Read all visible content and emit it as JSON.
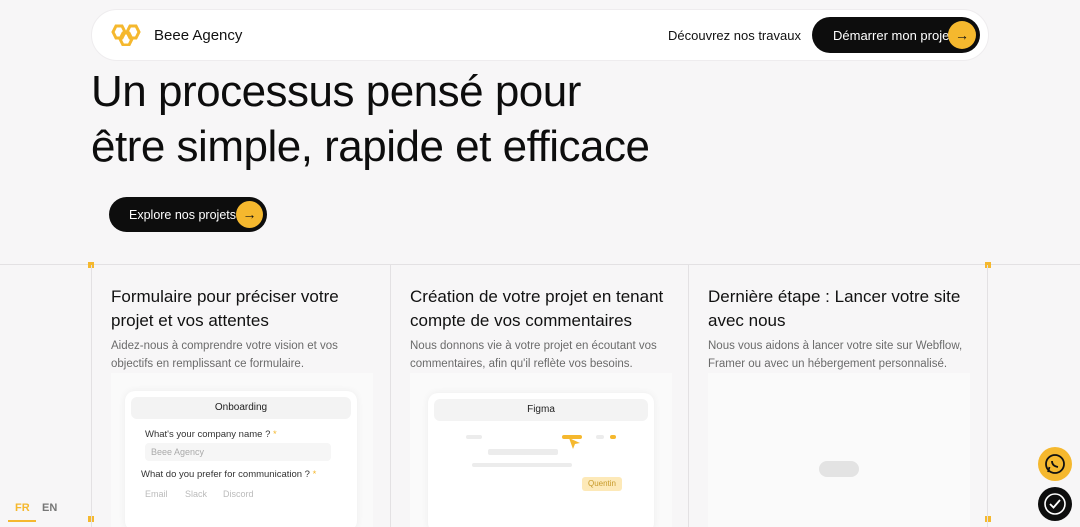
{
  "nav": {
    "brand": "Beee Agency",
    "link": "Découvrez nos travaux",
    "cta": "Démarrer mon projet",
    "brand_color": "#f5b82e"
  },
  "hero": {
    "title": "Un processus pensé pour être simple, rapide et efficace",
    "cta": "Explore nos projets"
  },
  "steps": [
    {
      "title": "Formulaire pour préciser votre projet et vos attentes",
      "text": "Aidez-nous à comprendre votre vision et vos objectifs en remplissant ce formulaire.",
      "mock": {
        "header": "Onboarding",
        "q1": "What's your company name ?",
        "a1": "Beee Agency",
        "q2": "What do you prefer for communication ?",
        "opts": [
          "Email",
          "Slack",
          "Discord"
        ],
        "star": "*"
      }
    },
    {
      "title": "Création de votre projet en tenant compte de vos commentaires",
      "text": "Nous donnons vie à votre projet en écoutant vos commentaires, afin qu'il reflète vos besoins.",
      "mock": {
        "header": "Figma",
        "tag": "Quentin"
      }
    },
    {
      "title": "Dernière étape : Lancer votre site avec nous",
      "text": "Nous vous aidons à lancer votre site sur Webflow, Framer ou avec un hébergement personnalisé."
    }
  ],
  "lang": {
    "fr": "FR",
    "en": "EN"
  },
  "icons": {
    "logo": "honeycomb-logo-icon",
    "arrow": "arrow-right-icon",
    "whatsapp": "whatsapp-icon",
    "cookie": "cookie-icon"
  }
}
